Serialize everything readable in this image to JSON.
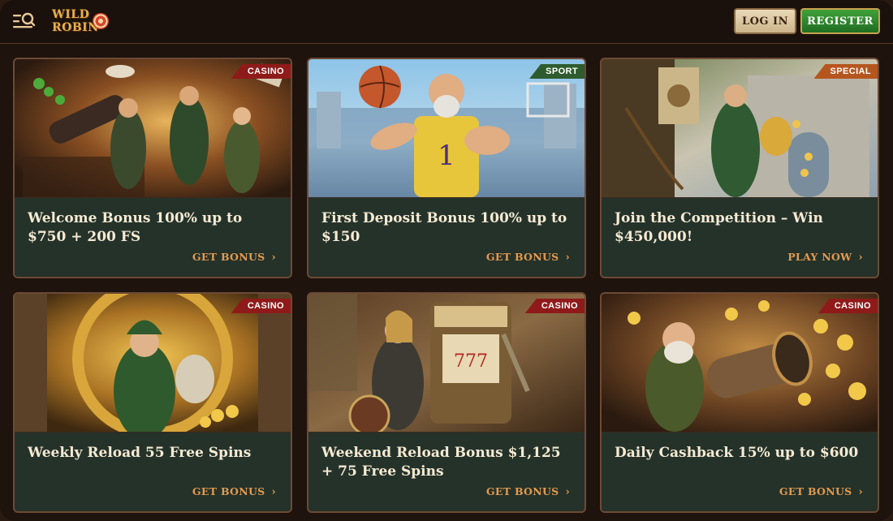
{
  "header": {
    "logo_line1": "WILD",
    "logo_line2": "ROBIN",
    "login_label": "LOG IN",
    "register_label": "REGISTER"
  },
  "colors": {
    "background": "#1e130d",
    "panel": "#24322a",
    "cta": "#e49a4f",
    "casino_badge": "#8f1a1a",
    "sport_badge": "#2f5c2f",
    "special_badge": "#b5561f",
    "register": "#2f8a2c"
  },
  "promos": [
    {
      "badge": "CASINO",
      "title": "Welcome Bonus 100% up to $750 + 200 FS",
      "cta": "GET BONUS",
      "image": "robin-hood-band-with-cannon"
    },
    {
      "badge": "SPORT",
      "title": "First Deposit Bonus 100% up to $150",
      "cta": "GET BONUS",
      "image": "basketball-player-sherwood-jersey"
    },
    {
      "badge": "SPECIAL",
      "title": "Join the Competition – Win $450,000!",
      "cta": "PLAY NOW",
      "image": "archer-with-gold-trophy-castle"
    },
    {
      "badge": "CASINO",
      "title": "Weekly Reload 55 Free Spins",
      "cta": "GET BONUS",
      "image": "hooded-archer-with-gold-sack-vault"
    },
    {
      "badge": "CASINO",
      "title": "Weekend Reload Bonus $1,125 + 75 Free Spins",
      "cta": "GET BONUS",
      "image": "woman-at-slot-machine"
    },
    {
      "badge": "CASINO",
      "title": "Daily Cashback 15% up to $600",
      "cta": "GET BONUS",
      "image": "man-with-coin-cannon"
    }
  ]
}
